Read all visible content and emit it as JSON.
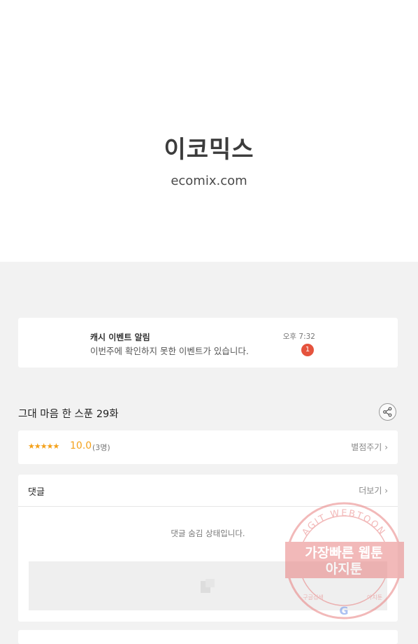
{
  "logo": {
    "text": "이코믹스",
    "url": "ecomix.com"
  },
  "notification": {
    "title": "캐시 이벤트 알림",
    "message": "이번주에 확인하지 못한 이벤트가 있습니다.",
    "time": "오후 7:32",
    "badge": "1"
  },
  "episode": {
    "title": "그대 마음 한 스푼 29화",
    "share_icon": "share-icon"
  },
  "rating": {
    "stars": "★★★★★",
    "score": "10.0",
    "count": "(3명)",
    "rate_link": "별점주기"
  },
  "comments": {
    "title": "댓글",
    "more_link": "더보기",
    "hidden_text": "댓글 숨김 상태입니다."
  },
  "watermark": {
    "top_text": "AGIT WEBTOON",
    "banner_line1": "가장빠른 웹툰",
    "banner_line2": "아지툰",
    "bottom_left": "구글검색",
    "bottom_right": "아지툰"
  },
  "colors": {
    "accent": "#f4a11a",
    "badge": "#e5533d",
    "watermark": "#e88080"
  }
}
